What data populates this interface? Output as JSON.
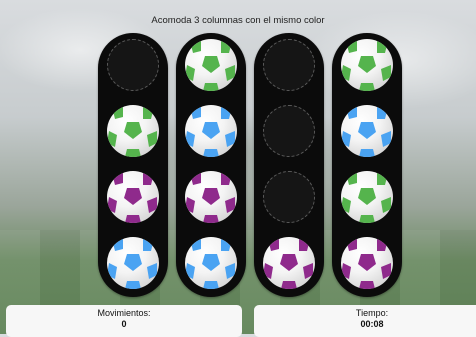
{
  "title": "Acomoda 3 columnas con el mismo color",
  "colors": {
    "green": "#55b44d",
    "blue": "#4aa3f2",
    "purple": "#8f2a8c"
  },
  "tubes": [
    [
      "empty",
      "green",
      "purple",
      "blue"
    ],
    [
      "green",
      "blue",
      "purple",
      "blue"
    ],
    [
      "empty",
      "empty",
      "empty",
      "purple"
    ],
    [
      "green",
      "blue",
      "green",
      "purple"
    ]
  ],
  "stats": {
    "moves_label": "Movimientos:",
    "moves_value": "0",
    "time_label": "Tiempo:",
    "time_value": "00:08"
  }
}
